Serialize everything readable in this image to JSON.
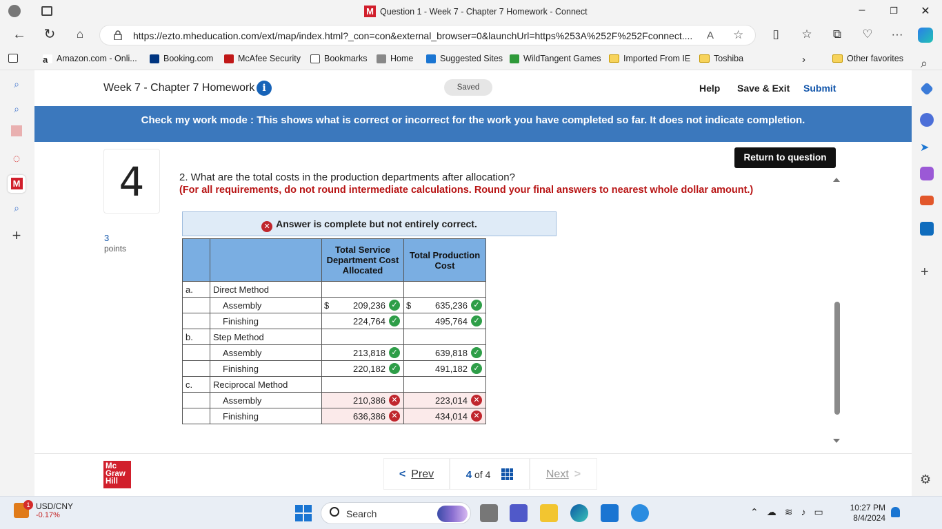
{
  "browser": {
    "window_title": "Question 1 - Week 7 - Chapter 7 Homework - Connect",
    "url": "https://ezto.mheducation.com/ext/map/index.html?_con=con&external_browser=0&launchUrl=https%253A%252F%252Fconnect....",
    "bookmarks": [
      "Amazon.com - Onli...",
      "Booking.com",
      "McAfee Security",
      "Bookmarks",
      "Home",
      "Suggested Sites",
      "WildTangent Games",
      "Imported From IE",
      "Toshiba"
    ],
    "other_favorites": "Other favorites"
  },
  "header": {
    "title": "Week 7 - Chapter 7 Homework",
    "saved": "Saved",
    "help": "Help",
    "save_exit": "Save & Exit",
    "submit": "Submit"
  },
  "banner": "Check my work mode : This shows what is correct or incorrect for the work you have completed so far. It does not indicate completion.",
  "question": {
    "number": "4",
    "points": "3",
    "points_label": "points",
    "return_button": "Return to question",
    "text": "2. What are the total costs in the production departments after allocation?",
    "instruction": "(For all requirements, do not round intermediate calculations. Round your final answers to nearest whole dollar amount.)",
    "result_message": "Answer is complete but not entirely correct."
  },
  "table": {
    "headers": [
      "",
      "",
      "Total Service Department Cost Allocated",
      "Total Production Cost"
    ],
    "currency_symbol": "$",
    "sections": [
      {
        "letter": "a.",
        "method": "Direct Method",
        "rows": [
          {
            "label": "Assembly",
            "allocated": "209,236",
            "allocated_correct": true,
            "total": "635,236",
            "total_correct": true,
            "show_dollar": true
          },
          {
            "label": "Finishing",
            "allocated": "224,764",
            "allocated_correct": true,
            "total": "495,764",
            "total_correct": true,
            "show_dollar": false
          }
        ]
      },
      {
        "letter": "b.",
        "method": "Step Method",
        "rows": [
          {
            "label": "Assembly",
            "allocated": "213,818",
            "allocated_correct": true,
            "total": "639,818",
            "total_correct": true,
            "show_dollar": false
          },
          {
            "label": "Finishing",
            "allocated": "220,182",
            "allocated_correct": true,
            "total": "491,182",
            "total_correct": true,
            "show_dollar": false
          }
        ]
      },
      {
        "letter": "c.",
        "method": "Reciprocal Method",
        "rows": [
          {
            "label": "Assembly",
            "allocated": "210,386",
            "allocated_correct": false,
            "total": "223,014",
            "total_correct": false,
            "show_dollar": false
          },
          {
            "label": "Finishing",
            "allocated": "636,386",
            "allocated_correct": false,
            "total": "434,014",
            "total_correct": false,
            "show_dollar": false
          }
        ]
      }
    ]
  },
  "footer": {
    "logo": "Mc Graw Hill",
    "prev": "Prev",
    "current_page": "4",
    "of": "of",
    "total_pages": "4",
    "next": "Next"
  },
  "taskbar": {
    "ticker_name": "USD/CNY",
    "ticker_change": "-0.17%",
    "ticker_badge": "1",
    "search": "Search",
    "time": "10:27 PM",
    "date": "8/4/2024"
  },
  "colors": {
    "banner": "#3b78bd",
    "table_header": "#7aaee2",
    "correct": "#2e9e48",
    "incorrect": "#c0262d",
    "instruction": "#b81414",
    "link": "#1155aa"
  }
}
